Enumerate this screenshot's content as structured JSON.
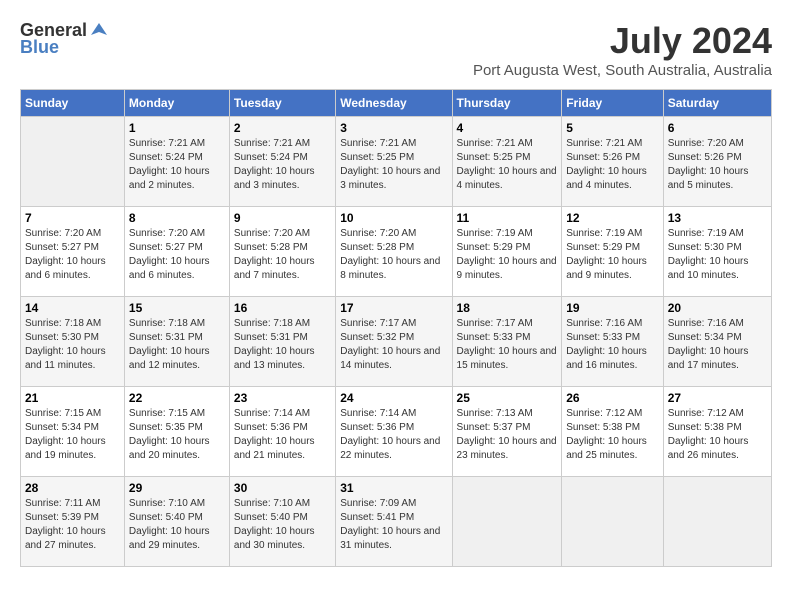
{
  "header": {
    "logo_general": "General",
    "logo_blue": "Blue",
    "month": "July 2024",
    "location": "Port Augusta West, South Australia, Australia"
  },
  "weekdays": [
    "Sunday",
    "Monday",
    "Tuesday",
    "Wednesday",
    "Thursday",
    "Friday",
    "Saturday"
  ],
  "weeks": [
    [
      {
        "day": "",
        "sunrise": "",
        "sunset": "",
        "daylight": ""
      },
      {
        "day": "1",
        "sunrise": "Sunrise: 7:21 AM",
        "sunset": "Sunset: 5:24 PM",
        "daylight": "Daylight: 10 hours and 2 minutes."
      },
      {
        "day": "2",
        "sunrise": "Sunrise: 7:21 AM",
        "sunset": "Sunset: 5:24 PM",
        "daylight": "Daylight: 10 hours and 3 minutes."
      },
      {
        "day": "3",
        "sunrise": "Sunrise: 7:21 AM",
        "sunset": "Sunset: 5:25 PM",
        "daylight": "Daylight: 10 hours and 3 minutes."
      },
      {
        "day": "4",
        "sunrise": "Sunrise: 7:21 AM",
        "sunset": "Sunset: 5:25 PM",
        "daylight": "Daylight: 10 hours and 4 minutes."
      },
      {
        "day": "5",
        "sunrise": "Sunrise: 7:21 AM",
        "sunset": "Sunset: 5:26 PM",
        "daylight": "Daylight: 10 hours and 4 minutes."
      },
      {
        "day": "6",
        "sunrise": "Sunrise: 7:20 AM",
        "sunset": "Sunset: 5:26 PM",
        "daylight": "Daylight: 10 hours and 5 minutes."
      }
    ],
    [
      {
        "day": "7",
        "sunrise": "Sunrise: 7:20 AM",
        "sunset": "Sunset: 5:27 PM",
        "daylight": "Daylight: 10 hours and 6 minutes."
      },
      {
        "day": "8",
        "sunrise": "Sunrise: 7:20 AM",
        "sunset": "Sunset: 5:27 PM",
        "daylight": "Daylight: 10 hours and 6 minutes."
      },
      {
        "day": "9",
        "sunrise": "Sunrise: 7:20 AM",
        "sunset": "Sunset: 5:28 PM",
        "daylight": "Daylight: 10 hours and 7 minutes."
      },
      {
        "day": "10",
        "sunrise": "Sunrise: 7:20 AM",
        "sunset": "Sunset: 5:28 PM",
        "daylight": "Daylight: 10 hours and 8 minutes."
      },
      {
        "day": "11",
        "sunrise": "Sunrise: 7:19 AM",
        "sunset": "Sunset: 5:29 PM",
        "daylight": "Daylight: 10 hours and 9 minutes."
      },
      {
        "day": "12",
        "sunrise": "Sunrise: 7:19 AM",
        "sunset": "Sunset: 5:29 PM",
        "daylight": "Daylight: 10 hours and 9 minutes."
      },
      {
        "day": "13",
        "sunrise": "Sunrise: 7:19 AM",
        "sunset": "Sunset: 5:30 PM",
        "daylight": "Daylight: 10 hours and 10 minutes."
      }
    ],
    [
      {
        "day": "14",
        "sunrise": "Sunrise: 7:18 AM",
        "sunset": "Sunset: 5:30 PM",
        "daylight": "Daylight: 10 hours and 11 minutes."
      },
      {
        "day": "15",
        "sunrise": "Sunrise: 7:18 AM",
        "sunset": "Sunset: 5:31 PM",
        "daylight": "Daylight: 10 hours and 12 minutes."
      },
      {
        "day": "16",
        "sunrise": "Sunrise: 7:18 AM",
        "sunset": "Sunset: 5:31 PM",
        "daylight": "Daylight: 10 hours and 13 minutes."
      },
      {
        "day": "17",
        "sunrise": "Sunrise: 7:17 AM",
        "sunset": "Sunset: 5:32 PM",
        "daylight": "Daylight: 10 hours and 14 minutes."
      },
      {
        "day": "18",
        "sunrise": "Sunrise: 7:17 AM",
        "sunset": "Sunset: 5:33 PM",
        "daylight": "Daylight: 10 hours and 15 minutes."
      },
      {
        "day": "19",
        "sunrise": "Sunrise: 7:16 AM",
        "sunset": "Sunset: 5:33 PM",
        "daylight": "Daylight: 10 hours and 16 minutes."
      },
      {
        "day": "20",
        "sunrise": "Sunrise: 7:16 AM",
        "sunset": "Sunset: 5:34 PM",
        "daylight": "Daylight: 10 hours and 17 minutes."
      }
    ],
    [
      {
        "day": "21",
        "sunrise": "Sunrise: 7:15 AM",
        "sunset": "Sunset: 5:34 PM",
        "daylight": "Daylight: 10 hours and 19 minutes."
      },
      {
        "day": "22",
        "sunrise": "Sunrise: 7:15 AM",
        "sunset": "Sunset: 5:35 PM",
        "daylight": "Daylight: 10 hours and 20 minutes."
      },
      {
        "day": "23",
        "sunrise": "Sunrise: 7:14 AM",
        "sunset": "Sunset: 5:36 PM",
        "daylight": "Daylight: 10 hours and 21 minutes."
      },
      {
        "day": "24",
        "sunrise": "Sunrise: 7:14 AM",
        "sunset": "Sunset: 5:36 PM",
        "daylight": "Daylight: 10 hours and 22 minutes."
      },
      {
        "day": "25",
        "sunrise": "Sunrise: 7:13 AM",
        "sunset": "Sunset: 5:37 PM",
        "daylight": "Daylight: 10 hours and 23 minutes."
      },
      {
        "day": "26",
        "sunrise": "Sunrise: 7:12 AM",
        "sunset": "Sunset: 5:38 PM",
        "daylight": "Daylight: 10 hours and 25 minutes."
      },
      {
        "day": "27",
        "sunrise": "Sunrise: 7:12 AM",
        "sunset": "Sunset: 5:38 PM",
        "daylight": "Daylight: 10 hours and 26 minutes."
      }
    ],
    [
      {
        "day": "28",
        "sunrise": "Sunrise: 7:11 AM",
        "sunset": "Sunset: 5:39 PM",
        "daylight": "Daylight: 10 hours and 27 minutes."
      },
      {
        "day": "29",
        "sunrise": "Sunrise: 7:10 AM",
        "sunset": "Sunset: 5:40 PM",
        "daylight": "Daylight: 10 hours and 29 minutes."
      },
      {
        "day": "30",
        "sunrise": "Sunrise: 7:10 AM",
        "sunset": "Sunset: 5:40 PM",
        "daylight": "Daylight: 10 hours and 30 minutes."
      },
      {
        "day": "31",
        "sunrise": "Sunrise: 7:09 AM",
        "sunset": "Sunset: 5:41 PM",
        "daylight": "Daylight: 10 hours and 31 minutes."
      },
      {
        "day": "",
        "sunrise": "",
        "sunset": "",
        "daylight": ""
      },
      {
        "day": "",
        "sunrise": "",
        "sunset": "",
        "daylight": ""
      },
      {
        "day": "",
        "sunrise": "",
        "sunset": "",
        "daylight": ""
      }
    ]
  ]
}
